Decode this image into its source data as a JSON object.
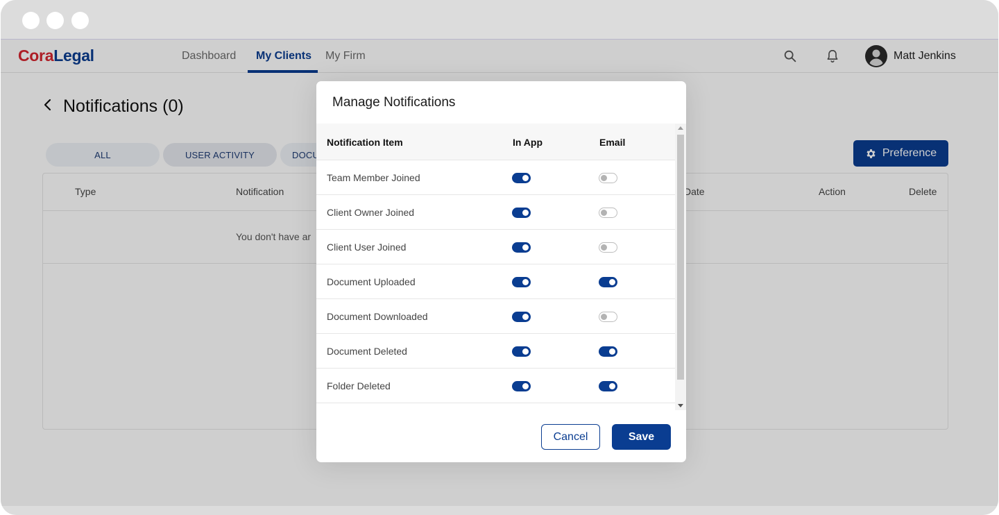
{
  "app": {
    "logo_part1": "Cora",
    "logo_part2": "Legal",
    "nav": [
      {
        "label": "Dashboard",
        "active": false
      },
      {
        "label": "My Clients",
        "active": true
      },
      {
        "label": "My Firm",
        "active": false
      }
    ],
    "user_name": "Matt Jenkins",
    "icons": {
      "search": "search-icon",
      "notifications": "bell-icon",
      "avatar": "user-avatar-icon"
    }
  },
  "page": {
    "title": "Notifications (0)",
    "filter_tabs": [
      "ALL",
      "USER ACTIVITY",
      "DOCU"
    ],
    "preference_label": "Preference",
    "table_headers": {
      "type": "Type",
      "notification": "Notification",
      "date": "Date",
      "action": "Action",
      "delete": "Delete"
    },
    "empty_text": "You don't have ar"
  },
  "modal": {
    "title": "Manage Notifications",
    "columns": {
      "item": "Notification Item",
      "in_app": "In App",
      "email": "Email"
    },
    "rows": [
      {
        "label": "Team Member Joined",
        "in_app": true,
        "email": false
      },
      {
        "label": "Client Owner Joined",
        "in_app": true,
        "email": false
      },
      {
        "label": "Client User Joined",
        "in_app": true,
        "email": false
      },
      {
        "label": "Document Uploaded",
        "in_app": true,
        "email": true
      },
      {
        "label": "Document Downloaded",
        "in_app": true,
        "email": false
      },
      {
        "label": "Document Deleted",
        "in_app": true,
        "email": true
      },
      {
        "label": "Folder Deleted",
        "in_app": true,
        "email": true
      }
    ],
    "cancel_label": "Cancel",
    "save_label": "Save"
  },
  "colors": {
    "brand_blue": "#0a3d91",
    "brand_red": "#d6252f"
  }
}
